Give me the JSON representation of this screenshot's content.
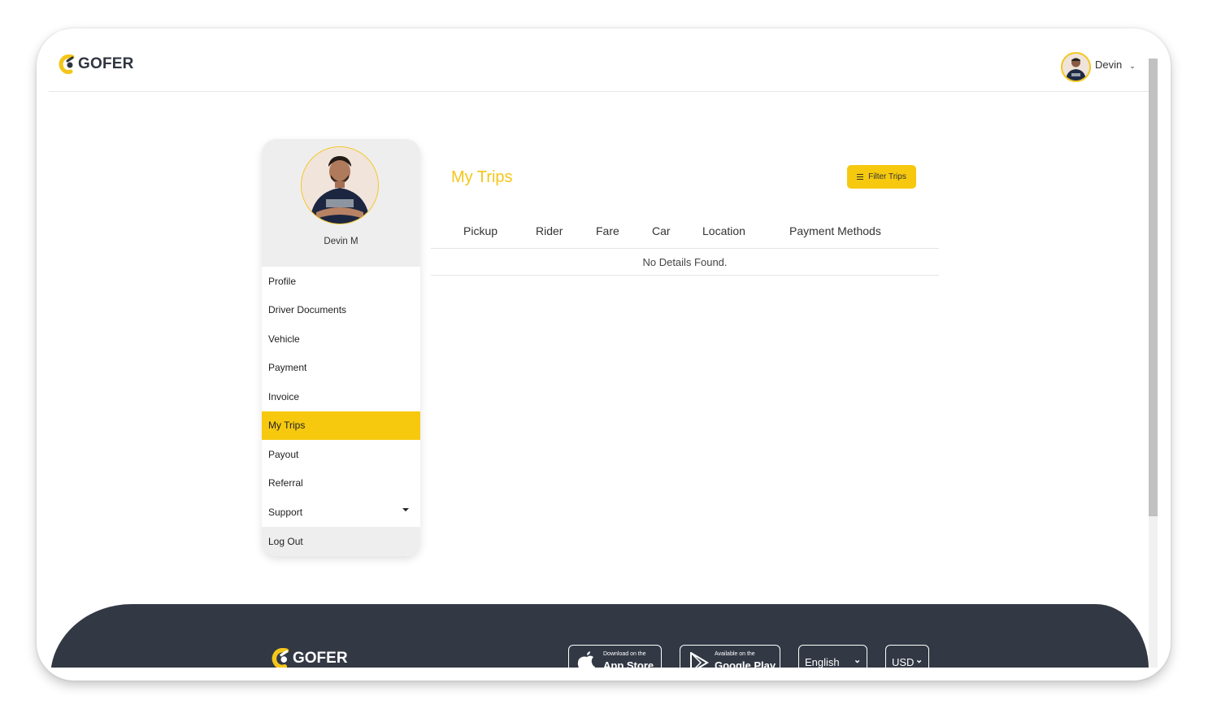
{
  "header": {
    "brand": "GOFER",
    "user_name": "Devin",
    "user_menu_chevron": "⌄"
  },
  "sidebar": {
    "profile_name": "Devin M",
    "items": [
      {
        "label": "Profile"
      },
      {
        "label": "Driver Documents"
      },
      {
        "label": "Vehicle"
      },
      {
        "label": "Payment"
      },
      {
        "label": "Invoice"
      },
      {
        "label": "My Trips",
        "active": true
      },
      {
        "label": "Payout"
      },
      {
        "label": "Referral"
      },
      {
        "label": "Support",
        "has_dropdown": true
      }
    ],
    "logout_label": "Log Out"
  },
  "main": {
    "title": "My Trips",
    "filter_button_label": "Filter Trips",
    "table": {
      "columns": [
        "Pickup",
        "Rider",
        "Fare",
        "Car",
        "Location",
        "Payment Methods"
      ],
      "rows": [],
      "empty_message": "No Details Found."
    }
  },
  "footer": {
    "brand": "GOFER",
    "app_store": {
      "small": "Download on the",
      "big": "App Store"
    },
    "google_play": {
      "small": "Available on the",
      "big": "Google Play"
    },
    "language": "English",
    "currency": "USD"
  },
  "colors": {
    "accent": "#f6c90f",
    "title": "#f4c61a",
    "footer_bg": "#323844",
    "sidebar_bg": "#eeeeee"
  }
}
